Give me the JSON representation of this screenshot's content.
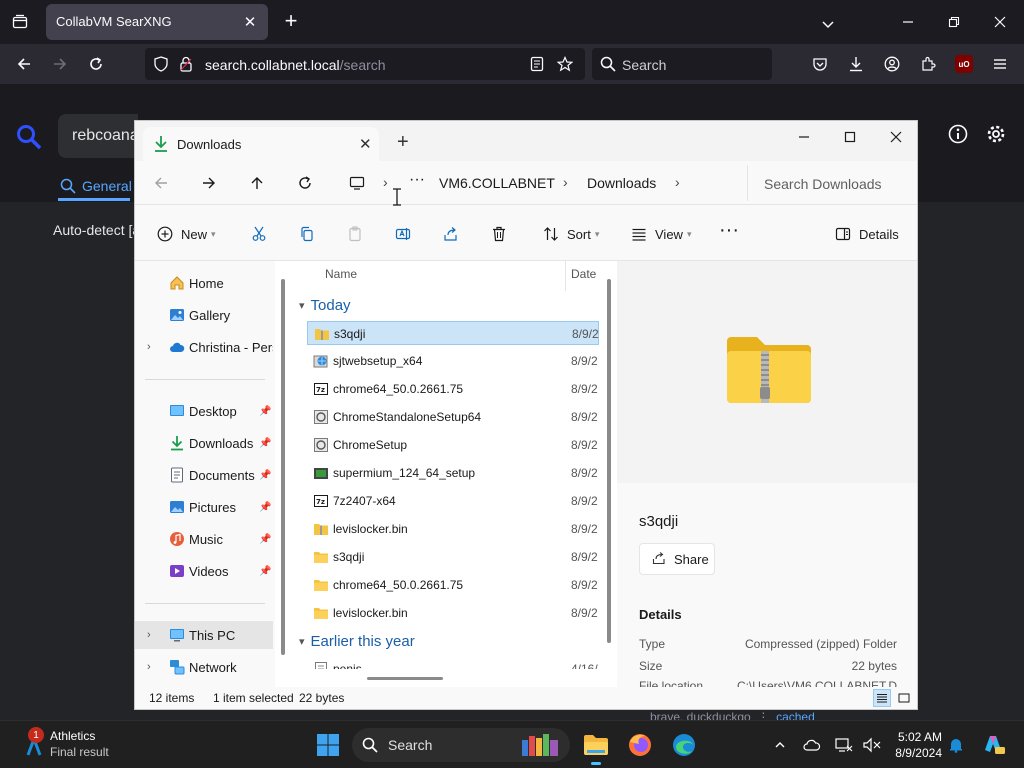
{
  "browser": {
    "tab_title": "CollabVM SearXNG",
    "url_domain": "search.collabnet.local",
    "url_path": "/search",
    "search_placeholder": "Search",
    "ublock_label": "uO"
  },
  "page": {
    "search_query": "rebcoana",
    "category_general": "General",
    "autodetect": "Auto-detect [a",
    "engines_footer": "brave, duckduckgo",
    "cached": "cached"
  },
  "explorer": {
    "tab_title": "Downloads",
    "breadcrumbs": [
      "VM6.COLLABNET",
      "Downloads"
    ],
    "search_placeholder": "Search Downloads",
    "toolbar": {
      "new": "New",
      "sort": "Sort",
      "view": "View",
      "details": "Details"
    },
    "nav": {
      "home": "Home",
      "gallery": "Gallery",
      "onedrive": "Christina - Perso",
      "desktop": "Desktop",
      "downloads": "Downloads",
      "documents": "Documents",
      "pictures": "Pictures",
      "music": "Music",
      "videos": "Videos",
      "thispc": "This PC",
      "network": "Network"
    },
    "columns": {
      "name": "Name",
      "date": "Date"
    },
    "groups": {
      "today": "Today",
      "earlier": "Earlier this year"
    },
    "files": [
      {
        "name": "s3qdji",
        "date": "8/9/2",
        "icon": "zip-folder-icon"
      },
      {
        "name": "sjtwebsetup_x64",
        "date": "8/9/2",
        "icon": "installer-globe-icon"
      },
      {
        "name": "chrome64_50.0.2661.75",
        "date": "8/9/2",
        "icon": "7z-archive-icon"
      },
      {
        "name": "ChromeStandaloneSetup64",
        "date": "8/9/2",
        "icon": "setup-app-icon"
      },
      {
        "name": "ChromeSetup",
        "date": "8/9/2",
        "icon": "setup-app-icon"
      },
      {
        "name": "supermium_124_64_setup",
        "date": "8/9/2",
        "icon": "installer-app-icon"
      },
      {
        "name": "7z2407-x64",
        "date": "8/9/2",
        "icon": "7z-archive-icon"
      },
      {
        "name": "levislocker.bin",
        "date": "8/9/2",
        "icon": "zip-folder-icon"
      },
      {
        "name": "s3qdji",
        "date": "8/9/2",
        "icon": "folder-icon"
      },
      {
        "name": "chrome64_50.0.2661.75",
        "date": "8/9/2",
        "icon": "folder-icon"
      },
      {
        "name": "levislocker.bin",
        "date": "8/9/2",
        "icon": "folder-icon"
      }
    ],
    "earlier_files": [
      {
        "name": "penis",
        "date": "4/16/",
        "icon": "text-file-icon"
      }
    ],
    "detail": {
      "name": "s3qdji",
      "share": "Share",
      "heading": "Details",
      "type_label": "Type",
      "type_value": "Compressed (zipped) Folder",
      "size_label": "Size",
      "size_value": "22 bytes",
      "location_label": "File location",
      "location_value": "C:\\Users\\VM6.COLLABNET.D"
    },
    "status": {
      "items": "12 items",
      "selected": "1 item selected",
      "size": "22 bytes"
    }
  },
  "taskbar": {
    "widget_title": "Athletics",
    "widget_sub": "Final result",
    "widget_badge": "1",
    "search_placeholder": "Search",
    "time": "5:02 AM",
    "date": "8/9/2024"
  },
  "colors": {
    "accent": "#0f6cbd",
    "folder": "#f4c542",
    "selection": "#cce4f7"
  }
}
